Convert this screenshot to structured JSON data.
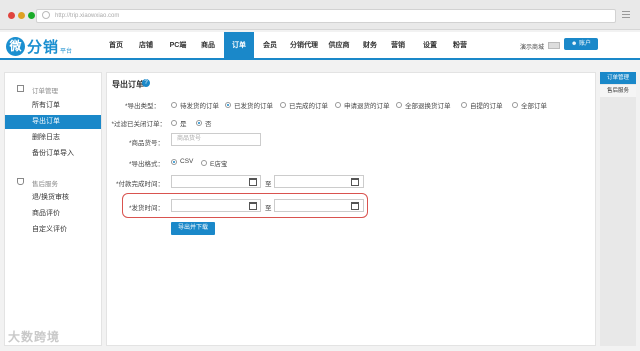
{
  "browser": {
    "url": "http://trip.xiaowxiao.com"
  },
  "logo": {
    "mark": "微",
    "name": "分销",
    "sub": "平台"
  },
  "nav": [
    "首页",
    "店铺",
    "PC端",
    "商品",
    "订单",
    "会员",
    "分销代理",
    "供应商",
    "财务",
    "营销",
    "设置",
    "粉营"
  ],
  "header": {
    "shop_label": "演示商城",
    "account_label": "账户"
  },
  "sidebar": {
    "section1": "订单管理",
    "items1": [
      "所有订单",
      "导出订单",
      "删除日志",
      "备份订单导入"
    ],
    "section2": "售后服务",
    "items2": [
      "退/换货审核",
      "商品评价",
      "自定义评价"
    ]
  },
  "rightbar": {
    "tabs": [
      "订单管理",
      "售后服务"
    ]
  },
  "page": {
    "title": "导出订单"
  },
  "form": {
    "type_label": "*导出类型：",
    "types": [
      "待发货的订单",
      "已发货的订单",
      "已完成的订单",
      "申请退货的订单",
      "全部退换货订单",
      "自提的订单",
      "全部订单"
    ],
    "filter_label": "*过滤已关闭订单：",
    "filter_opts": [
      "是",
      "否"
    ],
    "goods_label": "*商品货号：",
    "goods_placeholder": "商品货号",
    "format_label": "*导出格式：",
    "formats": [
      "CSV",
      "E店宝"
    ],
    "paytime_label": "*付款完成时间：",
    "shiptime_label": "*发货时间：",
    "zhi": "至",
    "submit": "导出并下载"
  },
  "watermark": "大数跨境"
}
